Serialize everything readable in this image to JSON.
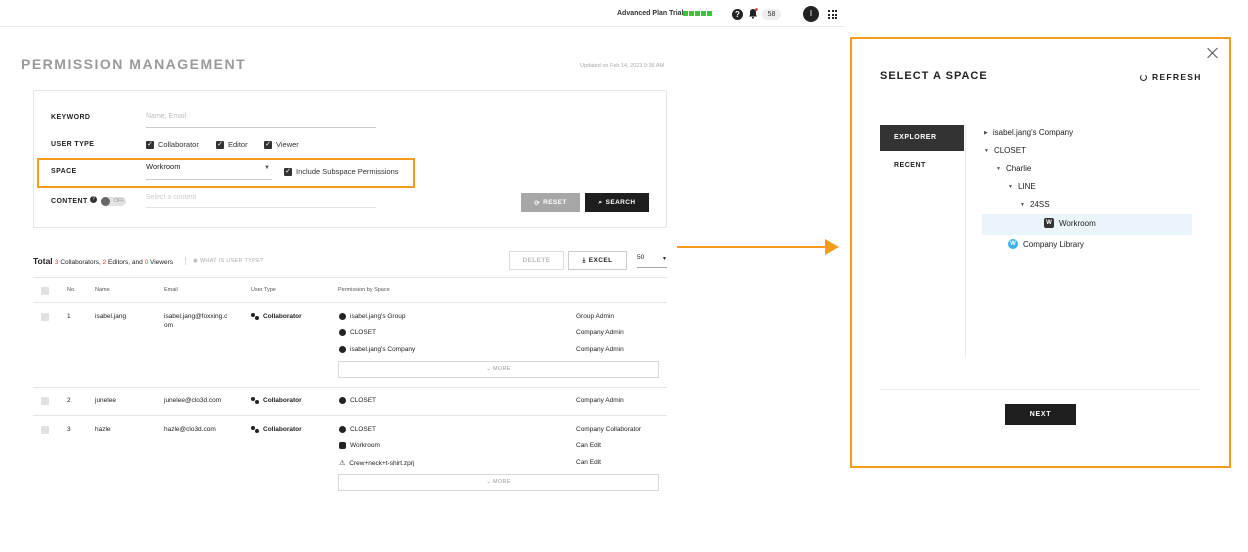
{
  "topbar": {
    "trial_label": "Advanced Plan Trial",
    "notif_count": "58",
    "avatar_initial": "I"
  },
  "page": {
    "title": "PERMISSION MANAGEMENT",
    "updated": "Updated on Feb 14, 2023 9:36 AM"
  },
  "filters": {
    "keyword_label": "KEYWORD",
    "keyword_placeholder": "Name, Email",
    "usertype_label": "USER TYPE",
    "usertype_options": [
      "Collaborator",
      "Editor",
      "Viewer"
    ],
    "space_label": "SPACE",
    "space_value": "Workroom",
    "include_subspace": "Include Subspace Permissions",
    "content_label": "CONTENT",
    "toggle_state": "OFF",
    "content_placeholder": "Select a content",
    "reset_label": "RESET",
    "search_label": "SEARCH"
  },
  "summary": {
    "total_label": "Total",
    "collab_count": "3",
    "collab_text": " Collaborators, ",
    "editor_count": "2",
    "editor_text": " Editors, and ",
    "viewer_count": "0",
    "viewer_text": " Viewers",
    "whatis": "WHAT IS USER TYPE?",
    "delete_label": "DELETE",
    "excel_label": "EXCEL",
    "per_page": "50"
  },
  "table": {
    "headers": [
      "No.",
      "Name",
      "Email",
      "User Type",
      "Permission by Space"
    ],
    "more_label": "MORE",
    "rows": [
      {
        "no": "1",
        "name": "isabel.jang",
        "email1": "isabel.jang@foxxing.c",
        "email2": "om",
        "usertype": "Collaborator",
        "perms": [
          {
            "space": "isabel.jang's Group",
            "role": "Group Admin"
          },
          {
            "space": "CLOSET",
            "role": "Company Admin"
          },
          {
            "space": "isabel.jang's Company",
            "role": "Company Admin"
          }
        ]
      },
      {
        "no": "2",
        "name": "junelee",
        "email1": "junelee@clo3d.com",
        "email2": "",
        "usertype": "Collaborator",
        "perms": [
          {
            "space": "CLOSET",
            "role": "Company Admin"
          }
        ]
      },
      {
        "no": "3",
        "name": "hazle",
        "email1": "hazle@clo3d.com",
        "email2": "",
        "usertype": "Collaborator",
        "perms": [
          {
            "space": "CLOSET",
            "role": "Company Collaborator"
          },
          {
            "space": "Workroom",
            "role": "Can Edit"
          },
          {
            "space": "Crew+neck+t-shirt.zprj",
            "role": "Can Edit"
          }
        ]
      }
    ]
  },
  "modal": {
    "title": "SELECT A SPACE",
    "refresh_label": "REFRESH",
    "tabs": [
      "EXPLORER",
      "RECENT"
    ],
    "tree": {
      "company": "isabel.jang's Company",
      "closet": "CLOSET",
      "charlie": "Charlie",
      "line": "LINE",
      "season": "24SS",
      "workroom": "Workroom",
      "library": "Company Library"
    },
    "next_label": "NEXT"
  },
  "colors": {
    "accent": "#f39c1d",
    "trial_green": "#3cc43c",
    "red": "#e03a3a",
    "library_blue": "#39b3e6"
  }
}
